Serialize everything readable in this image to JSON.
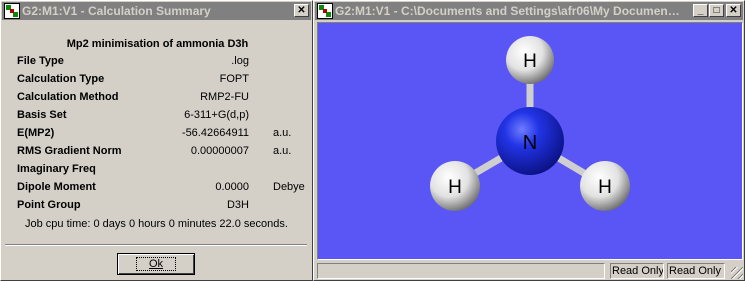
{
  "left_window": {
    "title": "G2:M1:V1 - Calculation Summary",
    "close_glyph": "✕",
    "heading": "Mp2 minimisation of ammonia D3h",
    "rows": [
      {
        "label": "File Type",
        "value": ".log",
        "unit": ""
      },
      {
        "label": "Calculation Type",
        "value": "FOPT",
        "unit": ""
      },
      {
        "label": "Calculation Method",
        "value": "RMP2-FU",
        "unit": ""
      },
      {
        "label": "Basis Set",
        "value": "6-311+G(d,p)",
        "unit": ""
      },
      {
        "label": "E(MP2)",
        "value": "-56.42664911",
        "unit": "a.u."
      },
      {
        "label": "RMS Gradient Norm",
        "value": "0.00000007",
        "unit": "a.u."
      },
      {
        "label": "Imaginary Freq",
        "value": "",
        "unit": ""
      },
      {
        "label": "Dipole Moment",
        "value": "0.0000",
        "unit": "Debye"
      },
      {
        "label": "Point Group",
        "value": "D3H",
        "unit": ""
      }
    ],
    "cpu_time": "Job cpu time:  0 days  0 hours  0 minutes 22.0 seconds.",
    "ok_label": "Ok"
  },
  "right_window": {
    "title": "G2:M1:V1 - C:\\Documents and Settings\\afr06\\My Documents...",
    "min_glyph": "_",
    "max_glyph": "□",
    "close_glyph": "✕",
    "viewport_bg": "#5a56f5",
    "atoms": [
      {
        "symbol": "H",
        "color": "#ffffff"
      },
      {
        "symbol": "N",
        "color": "#1f2fe0"
      },
      {
        "symbol": "H",
        "color": "#ffffff"
      },
      {
        "symbol": "H",
        "color": "#ffffff"
      }
    ],
    "status": {
      "main": "",
      "ro1": "Read Only",
      "ro2": "Read Only"
    }
  }
}
